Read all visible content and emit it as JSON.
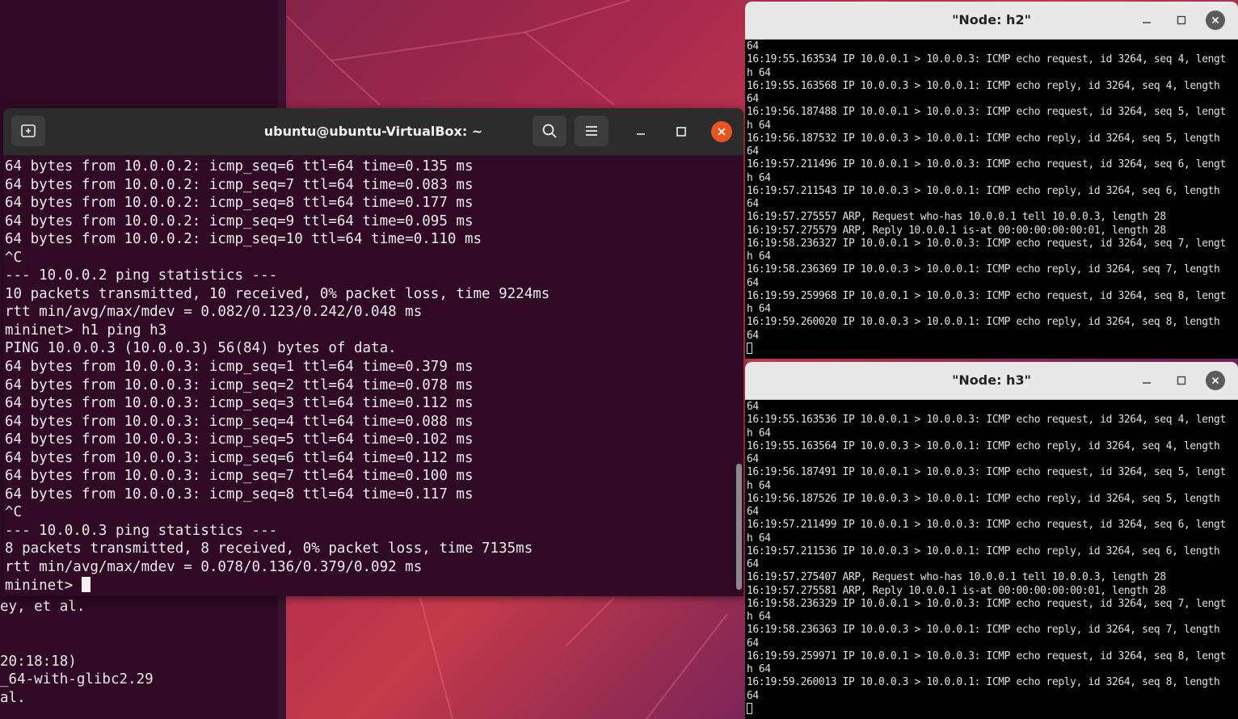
{
  "background_terminal": {
    "lines": [
      "ey, et al.",
      "",
      "",
      "20:18:18)",
      "_64-with-glibc2.29",
      "al."
    ]
  },
  "main_terminal": {
    "title": "ubuntu@ubuntu-VirtualBox: ~",
    "lines": [
      "64 bytes from 10.0.0.2: icmp_seq=6 ttl=64 time=0.135 ms",
      "64 bytes from 10.0.0.2: icmp_seq=7 ttl=64 time=0.083 ms",
      "64 bytes from 10.0.0.2: icmp_seq=8 ttl=64 time=0.177 ms",
      "64 bytes from 10.0.0.2: icmp_seq=9 ttl=64 time=0.095 ms",
      "64 bytes from 10.0.0.2: icmp_seq=10 ttl=64 time=0.110 ms",
      "^C",
      "--- 10.0.0.2 ping statistics ---",
      "10 packets transmitted, 10 received, 0% packet loss, time 9224ms",
      "rtt min/avg/max/mdev = 0.082/0.123/0.242/0.048 ms",
      "mininet> h1 ping h3",
      "PING 10.0.0.3 (10.0.0.3) 56(84) bytes of data.",
      "64 bytes from 10.0.0.3: icmp_seq=1 ttl=64 time=0.379 ms",
      "64 bytes from 10.0.0.3: icmp_seq=2 ttl=64 time=0.078 ms",
      "64 bytes from 10.0.0.3: icmp_seq=3 ttl=64 time=0.112 ms",
      "64 bytes from 10.0.0.3: icmp_seq=4 ttl=64 time=0.088 ms",
      "64 bytes from 10.0.0.3: icmp_seq=5 ttl=64 time=0.102 ms",
      "64 bytes from 10.0.0.3: icmp_seq=6 ttl=64 time=0.112 ms",
      "64 bytes from 10.0.0.3: icmp_seq=7 ttl=64 time=0.100 ms",
      "64 bytes from 10.0.0.3: icmp_seq=8 ttl=64 time=0.117 ms",
      "^C",
      "--- 10.0.0.3 ping statistics ---",
      "8 packets transmitted, 8 received, 0% packet loss, time 7135ms",
      "rtt min/avg/max/mdev = 0.078/0.136/0.379/0.092 ms"
    ],
    "prompt": "mininet> "
  },
  "node_h2": {
    "title": "\"Node: h2\"",
    "lines": [
      "64",
      "16:19:55.163534 IP 10.0.0.1 > 10.0.0.3: ICMP echo request, id 3264, seq 4, lengt",
      "h 64",
      "16:19:55.163568 IP 10.0.0.3 > 10.0.0.1: ICMP echo reply, id 3264, seq 4, length",
      "64",
      "16:19:56.187488 IP 10.0.0.1 > 10.0.0.3: ICMP echo request, id 3264, seq 5, lengt",
      "h 64",
      "16:19:56.187532 IP 10.0.0.3 > 10.0.0.1: ICMP echo reply, id 3264, seq 5, length",
      "64",
      "16:19:57.211496 IP 10.0.0.1 > 10.0.0.3: ICMP echo request, id 3264, seq 6, lengt",
      "h 64",
      "16:19:57.211543 IP 10.0.0.3 > 10.0.0.1: ICMP echo reply, id 3264, seq 6, length",
      "64",
      "16:19:57.275557 ARP, Request who-has 10.0.0.1 tell 10.0.0.3, length 28",
      "16:19:57.275579 ARP, Reply 10.0.0.1 is-at 00:00:00:00:00:01, length 28",
      "16:19:58.236327 IP 10.0.0.1 > 10.0.0.3: ICMP echo request, id 3264, seq 7, lengt",
      "h 64",
      "16:19:58.236369 IP 10.0.0.3 > 10.0.0.1: ICMP echo reply, id 3264, seq 7, length",
      "64",
      "16:19:59.259968 IP 10.0.0.1 > 10.0.0.3: ICMP echo request, id 3264, seq 8, lengt",
      "h 64",
      "16:19:59.260020 IP 10.0.0.3 > 10.0.0.1: ICMP echo reply, id 3264, seq 8, length",
      "64"
    ]
  },
  "node_h3": {
    "title": "\"Node: h3\"",
    "lines": [
      "64",
      "16:19:55.163536 IP 10.0.0.1 > 10.0.0.3: ICMP echo request, id 3264, seq 4, lengt",
      "h 64",
      "16:19:55.163564 IP 10.0.0.3 > 10.0.0.1: ICMP echo reply, id 3264, seq 4, length",
      "64",
      "16:19:56.187491 IP 10.0.0.1 > 10.0.0.3: ICMP echo request, id 3264, seq 5, lengt",
      "h 64",
      "16:19:56.187526 IP 10.0.0.3 > 10.0.0.1: ICMP echo reply, id 3264, seq 5, length",
      "64",
      "16:19:57.211499 IP 10.0.0.1 > 10.0.0.3: ICMP echo request, id 3264, seq 6, lengt",
      "h 64",
      "16:19:57.211536 IP 10.0.0.3 > 10.0.0.1: ICMP echo reply, id 3264, seq 6, length",
      "64",
      "16:19:57.275407 ARP, Request who-has 10.0.0.1 tell 10.0.0.3, length 28",
      "16:19:57.275581 ARP, Reply 10.0.0.1 is-at 00:00:00:00:00:01, length 28",
      "16:19:58.236329 IP 10.0.0.1 > 10.0.0.3: ICMP echo request, id 3264, seq 7, lengt",
      "h 64",
      "16:19:58.236363 IP 10.0.0.3 > 10.0.0.1: ICMP echo reply, id 3264, seq 7, length",
      "64",
      "16:19:59.259971 IP 10.0.0.1 > 10.0.0.3: ICMP echo request, id 3264, seq 8, lengt",
      "h 64",
      "16:19:59.260013 IP 10.0.0.3 > 10.0.0.1: ICMP echo reply, id 3264, seq 8, length",
      "64"
    ]
  },
  "icons": {
    "new_tab": "new-tab-icon",
    "search": "search-icon",
    "menu": "hamburger-menu-icon",
    "minimize": "minimize-icon",
    "maximize": "maximize-icon",
    "close": "close-icon"
  },
  "colors": {
    "terminal_bg": "#300a24",
    "close_accent": "#e95420",
    "node_bg": "#000000"
  }
}
